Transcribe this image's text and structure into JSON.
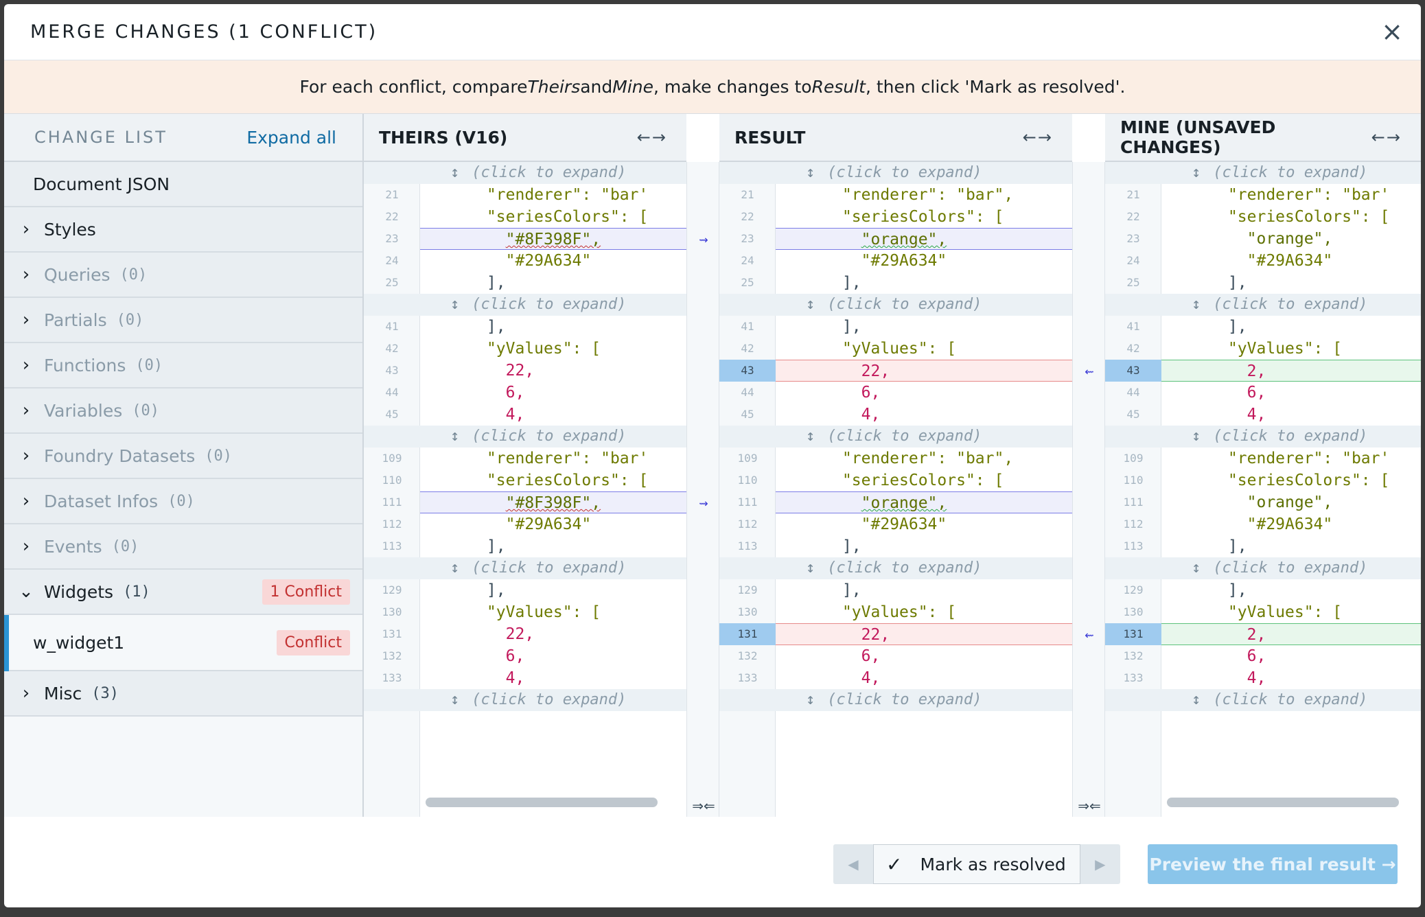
{
  "title": "MERGE CHANGES (1 CONFLICT)",
  "close_icon": "×",
  "banner": {
    "p1": "For each conflict, compare ",
    "theirs": "Theirs",
    "p2": " and ",
    "mine": "Mine",
    "p3": ", make changes to ",
    "result": "Result",
    "p4": ", then click 'Mark as resolved'."
  },
  "sidebar": {
    "header": "CHANGE LIST",
    "expand_all": "Expand all",
    "document": "Document JSON",
    "items": [
      {
        "label": "Styles",
        "count": ""
      },
      {
        "label": "Queries",
        "count": "(0)"
      },
      {
        "label": "Partials",
        "count": "(0)"
      },
      {
        "label": "Functions",
        "count": "(0)"
      },
      {
        "label": "Variables",
        "count": "(0)"
      },
      {
        "label": "Foundry Datasets",
        "count": "(0)"
      },
      {
        "label": "Dataset Infos",
        "count": "(0)"
      },
      {
        "label": "Events",
        "count": "(0)"
      },
      {
        "label": "Widgets",
        "count": "(1)",
        "badge": "1 Conflict"
      },
      {
        "label": "Misc",
        "count": "(3)"
      }
    ],
    "widget_child": {
      "label": "w_widget1",
      "badge": "Conflict"
    }
  },
  "panes": {
    "theirs": {
      "title": "THEIRS (V16)",
      "arrows": "←→"
    },
    "result": {
      "title": "RESULT",
      "arrows": "←→"
    },
    "mine": {
      "title": "MINE (UNSAVED CHANGES)",
      "arrows": "←→"
    }
  },
  "expand_text": "(click to expand)",
  "expand_icon": "↕",
  "code": {
    "renderer_theirs": "\"renderer\": \"bar'",
    "renderer_result": "\"renderer\": \"bar\",",
    "seriesColors_theirs": "\"seriesColors\": [",
    "seriesColors_mine": "\"seriesColors\": [",
    "theirs_color": "\"#8F398F\",",
    "result_color": "\"orange\",",
    "green_color": "\"#29A634\"",
    "close_bracket": "],",
    "yValues": "\"yValues\": [",
    "theirs_val": "22,",
    "result_val": "22,",
    "mine_val": "2,",
    "six": "6,",
    "four": "4,"
  },
  "line_numbers": {
    "block1": [
      "21",
      "22",
      "23",
      "24",
      "25"
    ],
    "block2": [
      "41",
      "42",
      "43",
      "44",
      "45"
    ],
    "block3": [
      "109",
      "110",
      "111",
      "112",
      "113"
    ],
    "block4": [
      "129",
      "130",
      "131",
      "132",
      "133"
    ]
  },
  "connectors": {
    "blue_arrow": "⇝",
    "left_arrow": "⇜",
    "bottom": "⇒⇐"
  },
  "footer": {
    "prev": "◀",
    "next": "▶",
    "check": "✓",
    "mark_resolved": "Mark as resolved",
    "preview": "Preview the final result →"
  }
}
